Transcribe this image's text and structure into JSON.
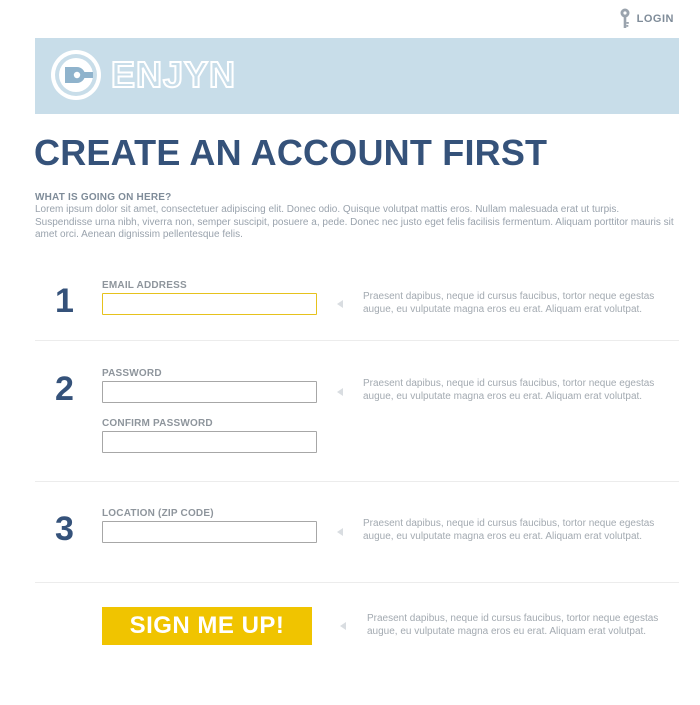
{
  "header": {
    "login_label": "LOGIN",
    "login_icon": "key-icon"
  },
  "brand": {
    "name": "ENJYN",
    "banner_color": "#c8dde9",
    "accent_color": "#35527a"
  },
  "page": {
    "title": "CREATE AN ACCOUNT FIRST",
    "intro_heading": "WHAT IS GOING ON HERE?",
    "intro_text": "Lorem ipsum dolor sit amet, consectetuer adipiscing elit. Donec odio. Quisque volutpat mattis eros. Nullam malesuada erat ut turpis. Suspendisse urna nibh, viverra non, semper suscipit, posuere a, pede. Donec nec justo eget felis facilisis fermentum. Aliquam porttitor mauris sit amet orci. Aenean dignissim pellentesque felis."
  },
  "steps": [
    {
      "number": "1",
      "fields": [
        {
          "label": "EMAIL ADDRESS",
          "value": "",
          "placeholder": ""
        }
      ],
      "help": "Praesent dapibus, neque id cursus faucibus, tortor neque egestas augue, eu vulputate magna eros eu erat. Aliquam erat volutpat."
    },
    {
      "number": "2",
      "fields": [
        {
          "label": "PASSWORD",
          "value": "",
          "placeholder": ""
        },
        {
          "label": "CONFIRM PASSWORD",
          "value": "",
          "placeholder": ""
        }
      ],
      "help": "Praesent dapibus, neque id cursus faucibus, tortor neque egestas augue, eu vulputate magna eros eu erat. Aliquam erat volutpat."
    },
    {
      "number": "3",
      "fields": [
        {
          "label": "LOCATION (ZIP CODE)",
          "value": "",
          "placeholder": ""
        }
      ],
      "help": "Praesent dapibus, neque id cursus faucibus, tortor neque egestas augue, eu vulputate magna eros eu erat. Aliquam erat volutpat."
    }
  ],
  "submit": {
    "label": "SIGN ME UP!",
    "color": "#f0c400",
    "help": "Praesent dapibus, neque id cursus faucibus, tortor neque egestas augue, eu vulputate magna eros eu erat. Aliquam erat volutpat."
  }
}
